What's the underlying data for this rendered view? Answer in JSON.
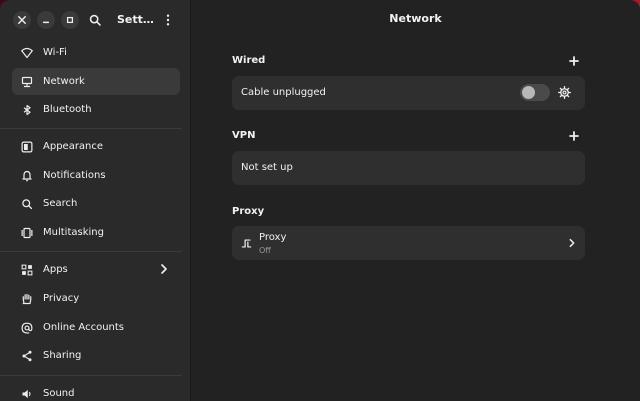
{
  "window": {
    "title": "Network"
  },
  "sidebar": {
    "title": "Sett…",
    "items": [
      {
        "label": "Wi-Fi",
        "icon": "wifi-icon"
      },
      {
        "label": "Network",
        "icon": "network-icon",
        "active": true
      },
      {
        "label": "Bluetooth",
        "icon": "bluetooth-icon"
      },
      {
        "label": "Appearance",
        "icon": "appearance-icon"
      },
      {
        "label": "Notifications",
        "icon": "notifications-icon"
      },
      {
        "label": "Search",
        "icon": "search-icon"
      },
      {
        "label": "Multitasking",
        "icon": "multitasking-icon"
      },
      {
        "label": "Apps",
        "icon": "apps-icon"
      },
      {
        "label": "Privacy",
        "icon": "hand-icon"
      },
      {
        "label": "Online Accounts",
        "icon": "at-icon"
      },
      {
        "label": "Sharing",
        "icon": "share-icon"
      },
      {
        "label": "Sound",
        "icon": "speaker-icon"
      }
    ]
  },
  "main": {
    "wired": {
      "title": "Wired",
      "status": "Cable unplugged",
      "enabled": false
    },
    "vpn": {
      "title": "VPN",
      "status": "Not set up"
    },
    "proxy": {
      "title": "Proxy",
      "label": "Proxy",
      "state": "Off"
    }
  },
  "colors": {
    "window_bg": "#222222",
    "sidebar_bg": "#2a2a2a",
    "card_bg": "#2f2f2f",
    "active_item": "#3a3a3a",
    "wallpaper": "#b21f2c"
  }
}
